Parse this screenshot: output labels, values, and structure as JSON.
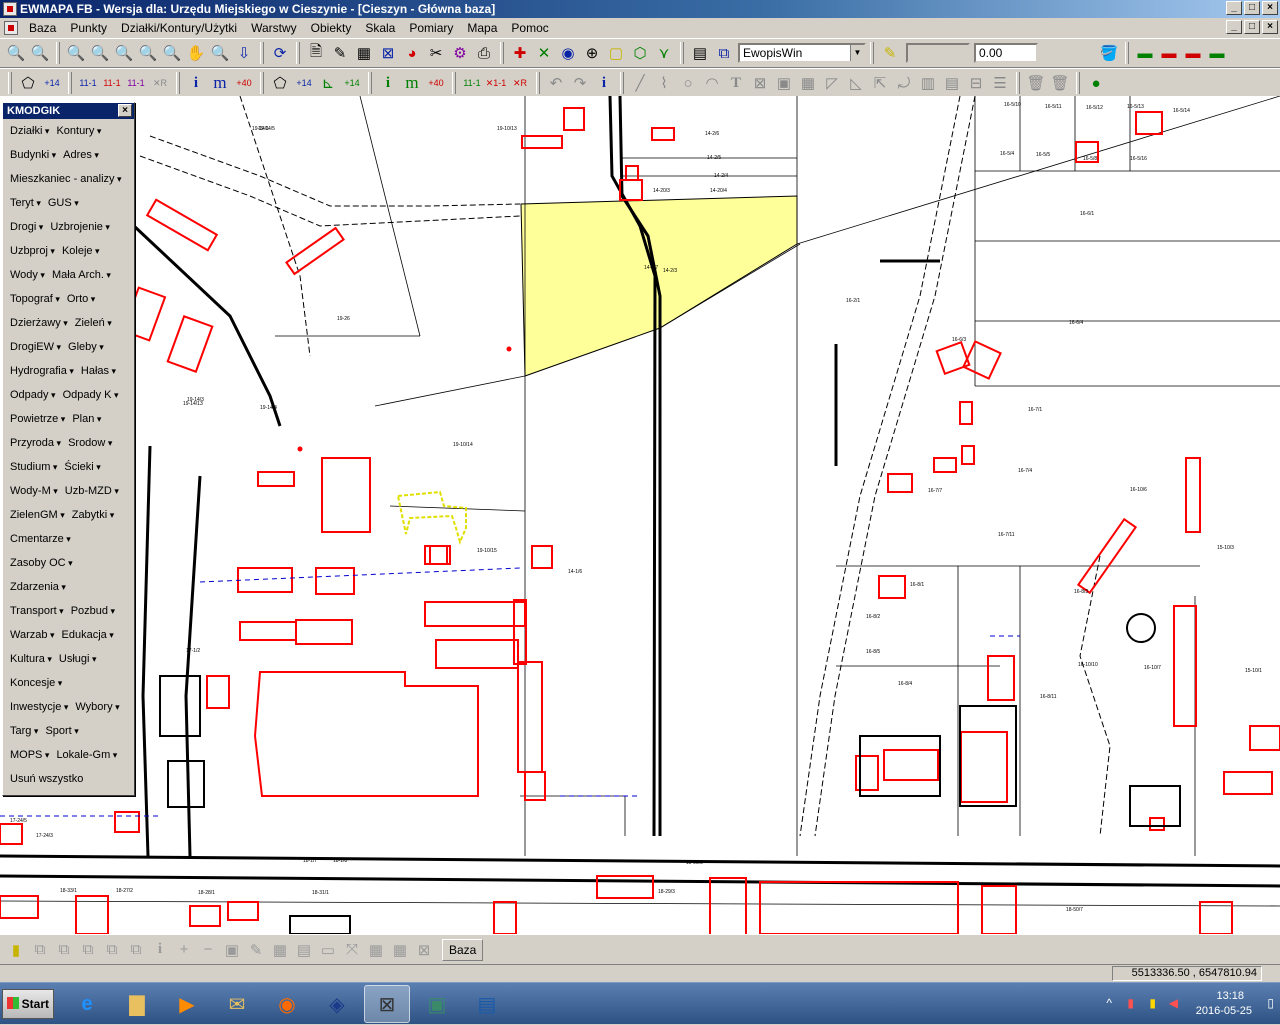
{
  "window": {
    "title": "EWMAPA FB - Wersja dla: Urzędu Miejskiego w Cieszynie - [Cieszyn - Główna baza]",
    "controls": [
      "_",
      "□",
      "×"
    ]
  },
  "menubar": {
    "items": [
      "Baza",
      "Punkty",
      "Działki/Kontury/Użytki",
      "Warstwy",
      "Obiekty",
      "Skala",
      "Pomiary",
      "Mapa",
      "Pomoc"
    ],
    "mdi_controls": [
      "_",
      "□",
      "×"
    ]
  },
  "toolbar1": {
    "layer_combo_value": "EwopisWin",
    "value_field": "0.00"
  },
  "toolbar2": {
    "labels": [
      "+14",
      "+14",
      "+14",
      "i",
      "m",
      "+40",
      "11-1",
      "11-1",
      "11-1",
      "i",
      "m",
      "+40"
    ]
  },
  "panel": {
    "title": "KMODGIK",
    "close": "×",
    "rows": [
      [
        "Działki",
        "Kontury"
      ],
      [
        "Budynki",
        "Adres"
      ],
      [
        "Mieszkaniec - analizy"
      ],
      [
        "Teryt",
        "GUS"
      ],
      [
        "Drogi",
        "Uzbrojenie"
      ],
      [
        "Uzbproj",
        "Koleje"
      ],
      [
        "Wody",
        "Mała Arch."
      ],
      [
        "Topograf",
        "Orto"
      ],
      [
        "Dzierżawy",
        "Zieleń"
      ],
      [
        "DrogiEW",
        "Gleby"
      ],
      [
        "Hydrografia",
        "Hałas"
      ],
      [
        "Odpady",
        "Odpady K"
      ],
      [
        "Powietrze",
        "Plan"
      ],
      [
        "Przyroda",
        "Srodow"
      ],
      [
        "Studium",
        "Ścieki"
      ],
      [
        "Wody-M",
        "Uzb-MZD"
      ],
      [
        "ZielenGM",
        "Zabytki"
      ],
      [
        "Cmentarze"
      ],
      [
        "Zasoby OC"
      ],
      [
        "Zdarzenia"
      ],
      [
        "Transport",
        "Pozbud"
      ],
      [
        "Warzab",
        "Edukacja"
      ],
      [
        "Kultura",
        "Usługi"
      ],
      [
        "Koncesje"
      ],
      [
        "Inwestycje",
        "Wybory"
      ],
      [
        "Targ",
        "Sport"
      ],
      [
        "MOPS",
        "Lokale-Gm"
      ],
      [
        "Usuń wszystko"
      ]
    ],
    "no_arrow": [
      "Usuń wszystko"
    ]
  },
  "map": {
    "parcel_labels": [
      "19-14/5",
      "19-10/13",
      "14-2/6",
      "14-2/5",
      "14-2/4",
      "14-20/4",
      "14-2/3",
      "14-20/3",
      "16-5/10",
      "16-5/11",
      "16-5/12",
      "16-5/13",
      "16-5/14",
      "16-5/4",
      "16-5/5",
      "16-5/8",
      "16-5/16",
      "19-14/1",
      "19-14/3",
      "19-26",
      "19-14/4",
      "19-14/13",
      "19-10/15",
      "19-10/14",
      "14-1/6",
      "14-1/7",
      "16-2/1",
      "16-6/1",
      "16-6/3",
      "16-6/4",
      "16-7/1",
      "16-7/4",
      "16-7/7",
      "16-7/11",
      "16-8/1",
      "16-8/2",
      "16-8/3",
      "16-8/4",
      "16-8/5",
      "16-8/11",
      "16-10/6",
      "16-10/7",
      "16-10/10",
      "15-10/1",
      "15-10/3",
      "17-1/2",
      "17-24/5",
      "17-24/3",
      "18-1/7",
      "18-1/8",
      "18-29/3",
      "18-28/3",
      "18-31/1",
      "18-28/1",
      "18-27/2",
      "18-33/1",
      "18-50/7"
    ]
  },
  "bottombar": {
    "baza_label": "Baza"
  },
  "status": {
    "coordinates": "5513336.50 , 6547810.94"
  },
  "taskbar": {
    "start_label": "Start",
    "time": "13:18",
    "date": "2016-05-25"
  },
  "colors": {
    "buildings": "#ff0000",
    "highlight_parcel": "#ffff99",
    "title_bar": "#0a246a"
  }
}
